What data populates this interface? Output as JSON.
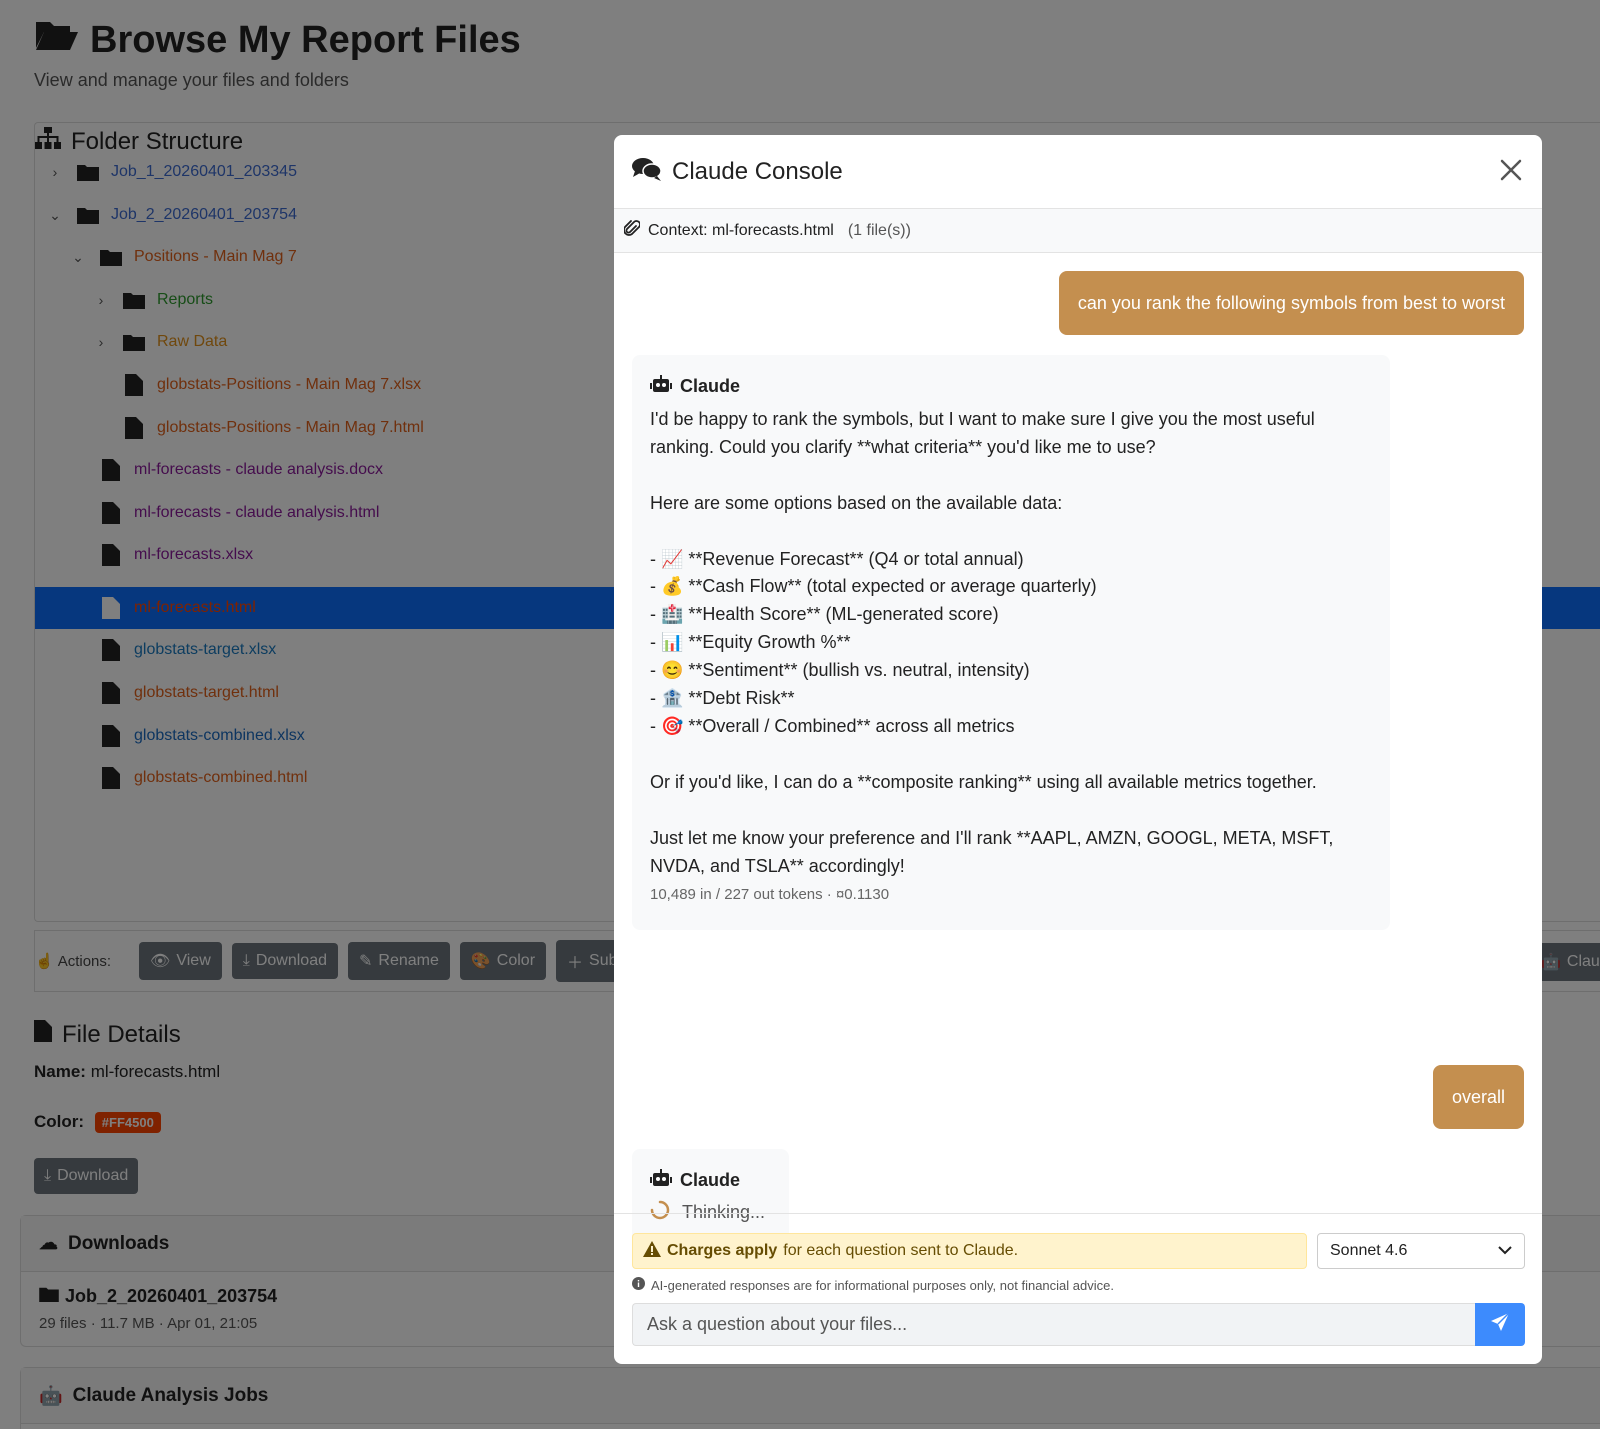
{
  "page": {
    "title": "Browse My Report Files",
    "subtitle": "View and manage your files and folders"
  },
  "tree": {
    "header": "Folder Structure",
    "items": [
      {
        "label": "Job_1_20260401_203345",
        "color": "#3d6bd0"
      },
      {
        "label": "Job_2_20260401_203754",
        "color": "#3d6bd0"
      },
      {
        "label": "Positions - Main Mag 7",
        "color": "#e0601a"
      },
      {
        "label": "Reports",
        "color": "#2e9a2e"
      },
      {
        "label": "Raw Data",
        "color": "#e0901a"
      },
      {
        "label": "globstats-Positions - Main Mag 7.xlsx",
        "color": "#e0601a"
      },
      {
        "label": "globstats-Positions - Main Mag 7.html",
        "color": "#e0601a"
      },
      {
        "label": "ml-forecasts - claude analysis.docx",
        "color": "#8a1a9a"
      },
      {
        "label": "ml-forecasts - claude analysis.html",
        "color": "#8a1a9a"
      },
      {
        "label": "ml-forecasts.xlsx",
        "color": "#8a1a9a"
      },
      {
        "label": "ml-forecasts.html",
        "color": "#ff4500"
      },
      {
        "label": "globstats-target.xlsx",
        "color": "#1a7ac0"
      },
      {
        "label": "globstats-target.html",
        "color": "#e0601a"
      },
      {
        "label": "globstats-combined.xlsx",
        "color": "#1a6ac0"
      },
      {
        "label": "globstats-combined.html",
        "color": "#e0601a"
      }
    ]
  },
  "actions": {
    "label": "Actions:",
    "view": "View",
    "download": "Download",
    "rename": "Rename",
    "color": "Color",
    "subfolder": "Subf",
    "claude": "Claude"
  },
  "file_details": {
    "title": "File Details",
    "name_label": "Name:",
    "name_value": "ml-forecasts.html",
    "color_label": "Color:",
    "color_value": "#FF4500",
    "download": "Download"
  },
  "downloads": {
    "title": "Downloads",
    "job_name": "Job_2_20260401_203754",
    "job_meta": "29 files · 11.7 MB · Apr 01, 21:05"
  },
  "analysis_jobs": {
    "title": "Claude Analysis Jobs"
  },
  "modal": {
    "title": "Claude Console",
    "context_label": "Context: ml-forecasts.html",
    "context_count": "(1 file(s))",
    "messages": {
      "user1": "can you rank the following symbols from best to worst",
      "bot1_name": "Claude",
      "bot1_text": "I'd be happy to rank the symbols, but I want to make sure I give you the most useful ranking. Could you clarify **what criteria** you'd like me to use?\n\nHere are some options based on the available data:\n\n- 📈 **Revenue Forecast** (Q4 or total annual)\n- 💰 **Cash Flow** (total expected or average quarterly)\n- 🏥 **Health Score** (ML-generated score)\n- 📊 **Equity Growth %**\n- 😊 **Sentiment** (bullish vs. neutral, intensity)\n- 🏦 **Debt Risk**\n- 🎯 **Overall / Combined** across all metrics\n\nOr if you'd like, I can do a **composite ranking** using all available metrics together.\n\nJust let me know your preference and I'll rank **AAPL, AMZN, GOOGL, META, MSFT, NVDA, and TSLA** accordingly!",
      "bot1_tokens": "10,489 in / 227 out tokens · ¤0.1130",
      "user2": "overall",
      "bot2_name": "Claude",
      "bot2_status": "Thinking..."
    },
    "footer": {
      "warning_bold": "Charges apply",
      "warning_rest": "for each question sent to Claude.",
      "model": "Sonnet 4.6",
      "disclaimer": "AI-generated responses are for informational purposes only, not financial advice.",
      "input_placeholder": "Ask a question about your files..."
    }
  },
  "colors": {
    "accent": "#0d6efd",
    "user_bubble": "#c48f4f",
    "warning_bg": "#fff3cd",
    "send": "#3d8bfd",
    "selected_row": "#0d6efd"
  }
}
